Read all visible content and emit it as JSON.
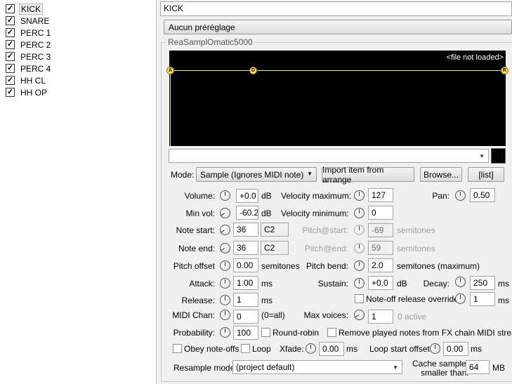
{
  "fx_list": [
    {
      "label": "KICK",
      "checked": true,
      "selected": true
    },
    {
      "label": "SNARE",
      "checked": true
    },
    {
      "label": "PERC 1",
      "checked": true
    },
    {
      "label": "PERC 2",
      "checked": true
    },
    {
      "label": "PERC 3",
      "checked": true
    },
    {
      "label": "PERC 4",
      "checked": true
    },
    {
      "label": "HH CL",
      "checked": true
    },
    {
      "label": "HH OP",
      "checked": true
    }
  ],
  "header": {
    "name": "KICK",
    "preset": "Aucun préréglage"
  },
  "plugin": {
    "title": "ReaSamplOmatic5000",
    "file_status": "<file not loaded>",
    "env_points": [
      "A",
      "D",
      "R"
    ],
    "file_combo": "",
    "mode_label": "Mode:",
    "mode_value": "Sample (Ignores MIDI note)",
    "import_btn": "Import item from arrange",
    "browse_btn": "Browse...",
    "list_btn": "[list]"
  },
  "params": {
    "volume": {
      "label": "Volume:",
      "value": "+0.0",
      "unit": "dB"
    },
    "min_vol": {
      "label": "Min vol:",
      "value": "-60.2",
      "unit": "dB"
    },
    "note_start": {
      "label": "Note start:",
      "value": "36",
      "note": "C2"
    },
    "note_end": {
      "label": "Note end:",
      "value": "36",
      "note": "C2"
    },
    "pitch_offset": {
      "label": "Pitch offset",
      "value": "0.00",
      "unit": "semitones"
    },
    "attack": {
      "label": "Attack:",
      "value": "1.00",
      "unit": "ms"
    },
    "release": {
      "label": "Release:",
      "value": "1",
      "unit": "ms"
    },
    "midi_chan": {
      "label": "MIDI Chan:",
      "value": "0",
      "unit": "(0=all)"
    },
    "probability": {
      "label": "Probability:",
      "value": "100"
    },
    "round_robin": {
      "label": "Round-robin"
    },
    "vel_max": {
      "label": "Velocity maximum:",
      "value": "127"
    },
    "vel_min": {
      "label": "Velocity minimum:",
      "value": "0"
    },
    "pitch_start": {
      "label": "Pitch@start:",
      "value": "-69",
      "unit": "semitones"
    },
    "pitch_end": {
      "label": "Pitch@end:",
      "value": "59",
      "unit": "semitones"
    },
    "pitch_bend": {
      "label": "Pitch bend:",
      "value": "2.0",
      "unit": "semitones (maximum)"
    },
    "sustain": {
      "label": "Sustain:",
      "value": "+0.0",
      "unit": "dB"
    },
    "noteoff_override": {
      "label": "Note-off release override:",
      "value": "1",
      "unit": "ms"
    },
    "max_voices": {
      "label": "Max voices:",
      "value": "1",
      "extra": "0 active"
    },
    "remove_played": {
      "label": "Remove played notes from FX chain MIDI stream"
    },
    "pan": {
      "label": "Pan:",
      "value": "0.50"
    },
    "decay": {
      "label": "Decay:",
      "value": "250",
      "unit": "ms"
    },
    "obey_noteoffs": {
      "label": "Obey note-offs"
    },
    "loop": {
      "label": "Loop"
    },
    "xfade": {
      "label": "Xfade:",
      "value": "0.00",
      "unit": "ms"
    },
    "loop_start_offset": {
      "label": "Loop start offset:",
      "value": "0.00",
      "unit": "ms"
    },
    "resample_mode": {
      "label": "Resample mode:",
      "value": "(project default)"
    },
    "cache": {
      "label1": "Cache samples",
      "label2": "smaller than:",
      "value": "64",
      "unit": "MB"
    }
  }
}
